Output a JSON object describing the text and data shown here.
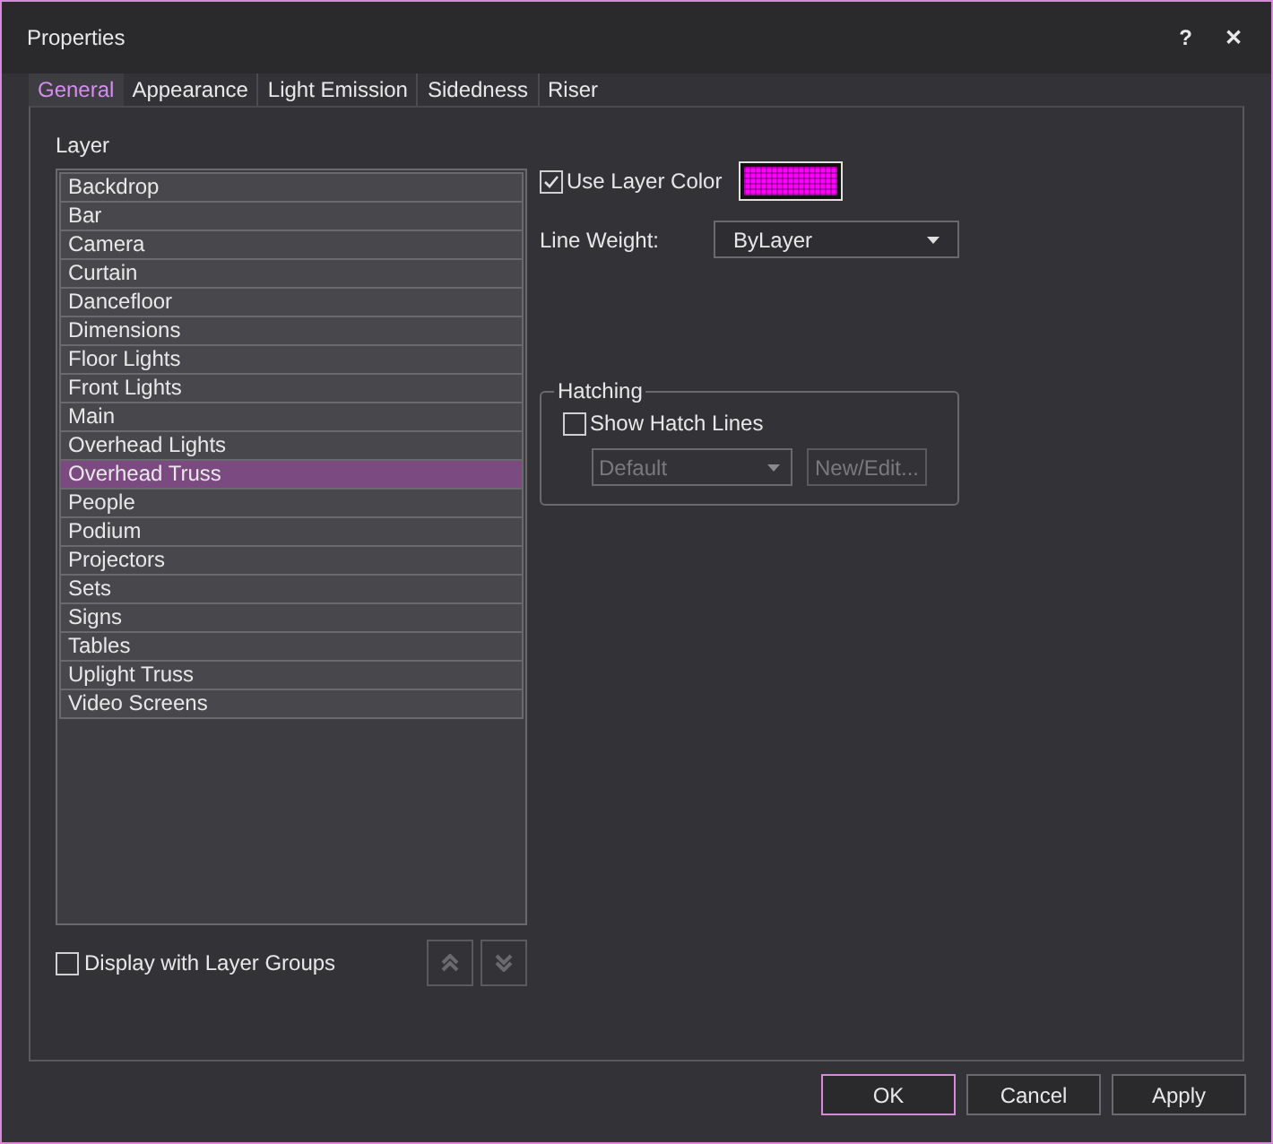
{
  "window": {
    "title": "Properties",
    "help": "?",
    "close": "✕"
  },
  "tabs": [
    {
      "label": "General",
      "selected": true
    },
    {
      "label": "Appearance",
      "selected": false
    },
    {
      "label": "Light Emission",
      "selected": false
    },
    {
      "label": "Sidedness",
      "selected": false
    },
    {
      "label": "Riser",
      "selected": false
    }
  ],
  "layer": {
    "label": "Layer",
    "items": [
      {
        "label": "Backdrop",
        "selected": false
      },
      {
        "label": "Bar",
        "selected": false
      },
      {
        "label": "Camera",
        "selected": false
      },
      {
        "label": "Curtain",
        "selected": false
      },
      {
        "label": "Dancefloor",
        "selected": false
      },
      {
        "label": "Dimensions",
        "selected": false
      },
      {
        "label": "Floor Lights",
        "selected": false
      },
      {
        "label": "Front Lights",
        "selected": false
      },
      {
        "label": "Main",
        "selected": false
      },
      {
        "label": "Overhead Lights",
        "selected": false
      },
      {
        "label": "Overhead Truss",
        "selected": true
      },
      {
        "label": "People",
        "selected": false
      },
      {
        "label": "Podium",
        "selected": false
      },
      {
        "label": "Projectors",
        "selected": false
      },
      {
        "label": "Sets",
        "selected": false
      },
      {
        "label": "Signs",
        "selected": false
      },
      {
        "label": "Tables",
        "selected": false
      },
      {
        "label": "Uplight Truss",
        "selected": false
      },
      {
        "label": "Video Screens",
        "selected": false
      }
    ],
    "display_with_groups": {
      "label": "Display with Layer Groups",
      "checked": false
    }
  },
  "use_layer_color": {
    "label": "Use Layer Color",
    "checked": true,
    "color": "#ff00ff"
  },
  "line_weight": {
    "label": "Line Weight:",
    "value": "ByLayer"
  },
  "hatching": {
    "title": "Hatching",
    "show_hatch_lines": {
      "label": "Show Hatch Lines",
      "checked": false
    },
    "pattern": {
      "value": "Default",
      "disabled": true
    },
    "new_edit": {
      "label": "New/Edit...",
      "disabled": true
    }
  },
  "buttons": [
    {
      "label": "OK",
      "default": true
    },
    {
      "label": "Cancel",
      "default": false
    },
    {
      "label": "Apply",
      "default": false
    }
  ]
}
